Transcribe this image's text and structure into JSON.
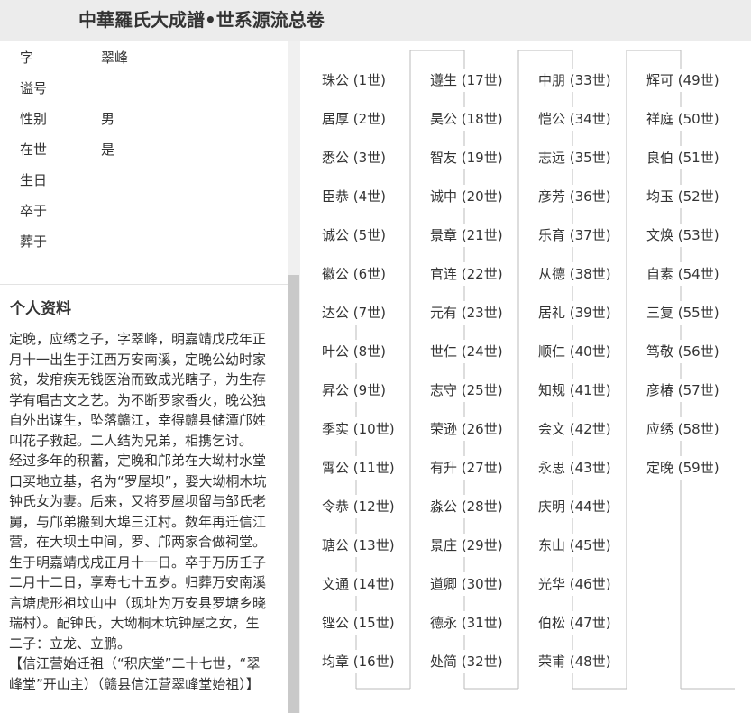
{
  "header": {
    "title": "中華羅氏大成譜•世系源流总卷"
  },
  "profile": {
    "rows": [
      {
        "label": "字",
        "value": "翠峰"
      },
      {
        "label": "谥号",
        "value": ""
      },
      {
        "label": "性别",
        "value": "男"
      },
      {
        "label": "在世",
        "value": "是"
      },
      {
        "label": "生日",
        "value": ""
      },
      {
        "label": "卒于",
        "value": ""
      },
      {
        "label": "葬于",
        "value": ""
      }
    ],
    "section_title": "个人资料",
    "bio": [
      "定晚，应绣之子，字翠峰，明嘉靖戊戌年正月十一出生于江西万安南溪，定晚公幼时家贫，发疳疾无钱医治而致成光瞎子，为生存学有唱古文之艺。为不断罗家香火，晚公独自外出谋生，坠落赣江，幸得赣县储潭邝姓叫花子救起。二人结为兄弟，相携乞讨。　经过多年的积蓄，定晚和邝弟在大坳村水堂口买地立基，名为“罗屋坝”，娶大坳桐木坑钟氏女为妻。后来，又将罗屋坝留与邹氏老舅，与邝弟搬到大埠三江村。数年再迁信江营，在大坝土中间，罗、邝两家合做祠堂。生于明嘉靖戊戌正月十一日。卒于万历壬子二月十二日，享寿七十五岁。归葬万安南溪言塘虎形祖坟山中（现址为万安县罗塘乡晓瑞村）。配钟氏，大坳桐木坑钟屋之女，生二子：立龙、立鹏。",
      "【信江营始迁祖（“积庆堂”二十七世，“翠峰堂”开山主）（赣县信江营翠峰堂始祖）】"
    ]
  },
  "generations": {
    "columns": [
      [
        {
          "name": "珠公",
          "gen": "(1世)"
        },
        {
          "name": "居厚",
          "gen": "(2世)"
        },
        {
          "name": "悉公",
          "gen": "(3世)"
        },
        {
          "name": "臣恭",
          "gen": "(4世)"
        },
        {
          "name": "诚公",
          "gen": "(5世)"
        },
        {
          "name": "徽公",
          "gen": "(6世)"
        },
        {
          "name": "达公",
          "gen": "(7世)"
        },
        {
          "name": "叶公",
          "gen": "(8世)"
        },
        {
          "name": "昇公",
          "gen": "(9世)"
        },
        {
          "name": "季实",
          "gen": "(10世)"
        },
        {
          "name": "霄公",
          "gen": "(11世)"
        },
        {
          "name": "令恭",
          "gen": "(12世)"
        },
        {
          "name": "瑭公",
          "gen": "(13世)"
        },
        {
          "name": "文通",
          "gen": "(14世)"
        },
        {
          "name": "铿公",
          "gen": "(15世)"
        },
        {
          "name": "均章",
          "gen": "(16世)"
        }
      ],
      [
        {
          "name": "遵生",
          "gen": "(17世)"
        },
        {
          "name": "昊公",
          "gen": "(18世)"
        },
        {
          "name": "智友",
          "gen": "(19世)"
        },
        {
          "name": "诚中",
          "gen": "(20世)"
        },
        {
          "name": "景章",
          "gen": "(21世)"
        },
        {
          "name": "官连",
          "gen": "(22世)"
        },
        {
          "name": "元有",
          "gen": "(23世)"
        },
        {
          "name": "世仁",
          "gen": "(24世)"
        },
        {
          "name": "志守",
          "gen": "(25世)"
        },
        {
          "name": "荣逊",
          "gen": "(26世)"
        },
        {
          "name": "有升",
          "gen": "(27世)"
        },
        {
          "name": "淼公",
          "gen": "(28世)"
        },
        {
          "name": "景庄",
          "gen": "(29世)"
        },
        {
          "name": "道卿",
          "gen": "(30世)"
        },
        {
          "name": "德永",
          "gen": "(31世)"
        },
        {
          "name": "处简",
          "gen": "(32世)"
        }
      ],
      [
        {
          "name": "中朋",
          "gen": "(33世)"
        },
        {
          "name": "恺公",
          "gen": "(34世)"
        },
        {
          "name": "志远",
          "gen": "(35世)"
        },
        {
          "name": "彦芳",
          "gen": "(36世)"
        },
        {
          "name": "乐育",
          "gen": "(37世)"
        },
        {
          "name": "从德",
          "gen": "(38世)"
        },
        {
          "name": "居礼",
          "gen": "(39世)"
        },
        {
          "name": "顺仁",
          "gen": "(40世)"
        },
        {
          "name": "知规",
          "gen": "(41世)"
        },
        {
          "name": "会文",
          "gen": "(42世)"
        },
        {
          "name": "永思",
          "gen": "(43世)"
        },
        {
          "name": "庆明",
          "gen": "(44世)"
        },
        {
          "name": "东山",
          "gen": "(45世)"
        },
        {
          "name": "光华",
          "gen": "(46世)"
        },
        {
          "name": "伯松",
          "gen": "(47世)"
        },
        {
          "name": "荣甫",
          "gen": "(48世)"
        }
      ],
      [
        {
          "name": "辉可",
          "gen": "(49世)"
        },
        {
          "name": "祥庭",
          "gen": "(50世)"
        },
        {
          "name": "良伯",
          "gen": "(51世)"
        },
        {
          "name": "均玉",
          "gen": "(52世)"
        },
        {
          "name": "文焕",
          "gen": "(53世)"
        },
        {
          "name": "自素",
          "gen": "(54世)"
        },
        {
          "name": "三复",
          "gen": "(55世)"
        },
        {
          "name": "笃敬",
          "gen": "(56世)"
        },
        {
          "name": "彦椿",
          "gen": "(57世)"
        },
        {
          "name": "应绣",
          "gen": "(58世)"
        },
        {
          "name": "定晚",
          "gen": "(59世)"
        }
      ]
    ]
  }
}
